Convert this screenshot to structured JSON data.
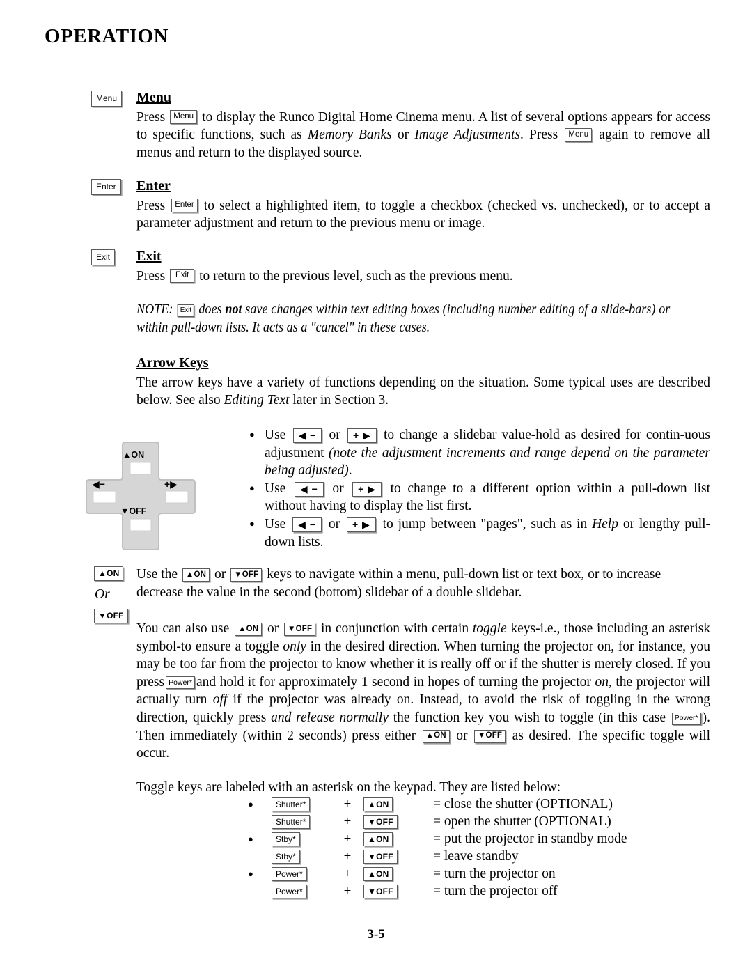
{
  "page": {
    "title": "OPERATION",
    "footer_page_number": "3-5"
  },
  "keys": {
    "menu": "Menu",
    "enter": "Enter",
    "exit": "Exit",
    "left_minus": "◀ −",
    "plus_right": "+ ▶",
    "up_on": "▲ON",
    "down_off": "▼OFF",
    "power": "Power*",
    "shutter": "Shutter*",
    "stby": "Stby*"
  },
  "sections": {
    "menu": {
      "heading": "Menu",
      "text_1": "Press",
      "text_2": "to display the Runco Digital Home Cinema menu. A list of several options appears for access to specific functions, such as",
      "em_1": "Memory Banks",
      "text_3": "or",
      "em_2": "Image Adjustments",
      "text_4": ". Press",
      "text_5": "again to remove all menus and return to the displayed source."
    },
    "enter": {
      "heading": "Enter",
      "text_1": "Press",
      "text_2": "to select a highlighted item, to toggle a checkbox (checked vs. unchecked), or to accept a parameter adjustment and return to the previous menu or image."
    },
    "exit": {
      "heading": "Exit",
      "text_1": "Press",
      "text_2": "to return to the previous level, such as the previous menu."
    },
    "note": {
      "label": "NOTE:",
      "text_1": "does",
      "bold_1": "not",
      "text_2": "save changes within text editing boxes (including number editing of a slide-bars) or within pull-down lists. It acts as a \"cancel\" in these cases."
    },
    "arrow_keys": {
      "heading": "Arrow Keys ",
      "intro_1": "The arrow keys have a variety of functions depending on the situation. Some typical uses are described below. See also",
      "intro_em": "Editing Text",
      "intro_2": "later in Section 3.",
      "bullets": [
        {
          "pre": "Use",
          "mid": "or",
          "post": "to change a slidebar value-hold as desired for contin-uous adjustment",
          "em": "(note the adjustment increments and range depend on the parameter being adjusted)",
          "tail": "."
        },
        {
          "pre": "Use",
          "mid": "or",
          "post": "to change to a different option within a pull-down list without having to display the list first.",
          "em": "",
          "tail": ""
        },
        {
          "pre": "Use",
          "mid": "or",
          "post": "to jump between \"pages\", such as in",
          "em": "Help",
          "tail": "or lengthy pull-down lists."
        }
      ]
    },
    "navigate": {
      "or_label": "Or",
      "text_1": "Use the",
      "text_2": "or",
      "text_3": "keys to navigate within a menu, pull-down list or text box, or to increase decrease the value in the second (bottom) slidebar of a double slidebar."
    },
    "toggle_paragraph": {
      "t1": "You can also use",
      "t2": "or",
      "t3": "in conjunction with certain",
      "em1": "toggle",
      "t4": "keys-i.e., those including an asterisk symbol-to ensure a toggle",
      "em2": "only",
      "t5": "in the desired direction. When turning the projector on, for instance, you may be too far from the projector to know whether it is really off or if the shutter is merely closed. If you press",
      "t6": "and hold it for approximately 1 second in hopes of turning the projector",
      "em3": "on",
      "t7": ", the projector will actually turn",
      "em4": "off",
      "t8": "if the projector was already on. Instead, to avoid the risk of toggling in the wrong direction, quickly press",
      "em5": "and release normally",
      "t9": "the function key you wish to toggle (in this case",
      "t10": "). Then immediately (within 2 seconds) press either",
      "t11": "or",
      "t12": "as desired. The specific toggle will occur."
    },
    "toggle_list": {
      "intro": "Toggle keys are labeled with an asterisk on the keypad. They are listed below:",
      "rows": [
        {
          "bullet": true,
          "key1": "Shutter*",
          "plus": "+",
          "key2": "▲ON",
          "desc": "= close the shutter (OPTIONAL)"
        },
        {
          "bullet": false,
          "key1": "Shutter*",
          "plus": "+",
          "key2": "▼OFF",
          "desc": "= open the shutter (OPTIONAL)"
        },
        {
          "bullet": true,
          "key1": "Stby*",
          "plus": "+",
          "key2": "▲ON",
          "desc": "= put the projector in standby mode"
        },
        {
          "bullet": false,
          "key1": "Stby*",
          "plus": "+",
          "key2": "▼OFF",
          "desc": "= leave standby"
        },
        {
          "bullet": true,
          "key1": "Power*",
          "plus": "+",
          "key2": "▲ON",
          "desc": "= turn the projector on"
        },
        {
          "bullet": false,
          "key1": "Power*",
          "plus": "+",
          "key2": "▼OFF",
          "desc": "= turn the projector off"
        }
      ]
    }
  },
  "keypad_graphic": {
    "up_label": "▲ON",
    "left_label": "◀−",
    "right_label": "+▶",
    "down_label": "▼OFF",
    "fill_color": "#d6d6d6",
    "edge_color": "#b9b9b9"
  }
}
